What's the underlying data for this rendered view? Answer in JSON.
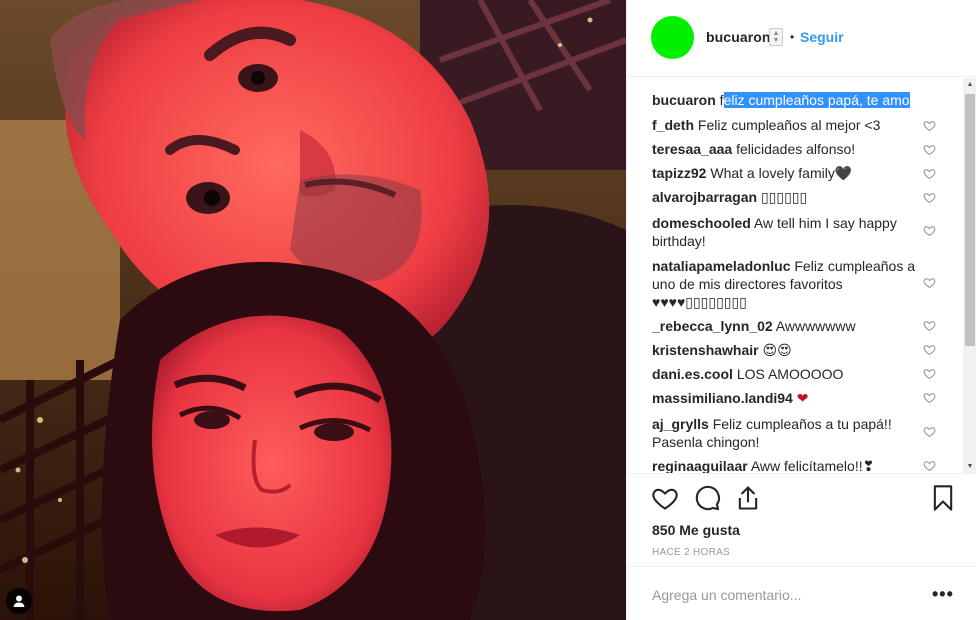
{
  "header": {
    "username": "bucuaron",
    "separator": "•",
    "follow_label": "Seguir",
    "avatar_color": "#00f000"
  },
  "comments": [
    {
      "user": "bucuaron",
      "text_plain": "f",
      "text_selected": "eliz cumpleaños papá, te amo"
    },
    {
      "user": "f_deth",
      "text": "Feliz cumpleaños al mejor <3"
    },
    {
      "user": "teresaa_aaa",
      "text": "felicidades alfonso!"
    },
    {
      "user": "tapizz92",
      "text": "What a lovely family🖤"
    },
    {
      "user": "alvarojbarragan",
      "text": "▯▯▯▯▯▯"
    },
    {
      "user": "domeschooled",
      "text": "Aw tell him I say happy birthday!"
    },
    {
      "user": "nataliapameladonluc",
      "text": "Feliz cumpleaños a uno de mis directores favoritos ♥♥♥♥▯▯▯▯▯▯▯▯"
    },
    {
      "user": "_rebecca_lynn_02",
      "text": "Awwwwwww"
    },
    {
      "user": "kristenshawhair",
      "text": "😍😍"
    },
    {
      "user": "dani.es.cool",
      "text": "LOS AMOOOOO"
    },
    {
      "user": "massimiliano.landi94",
      "text": "❤"
    },
    {
      "user": "aj_grylls",
      "text": "Feliz cumpleaños a tu papá!! Pasenla chingon!"
    },
    {
      "user": "reginaaguilaar",
      "text": "Aww felicítamelo!!❣"
    }
  ],
  "actions": {
    "like_icon": "heart-outline-icon",
    "comment_icon": "comment-bubble-icon",
    "share_icon": "share-upload-icon",
    "save_icon": "bookmark-icon"
  },
  "likes_text": "850 Me gusta",
  "time_text": "HACE 2 HORAS",
  "add_comment": {
    "placeholder": "Agrega un comentario..."
  },
  "more_label": "•••",
  "colors": {
    "link": "#3897f0",
    "selection": "#3390ff",
    "text": "#262626"
  }
}
